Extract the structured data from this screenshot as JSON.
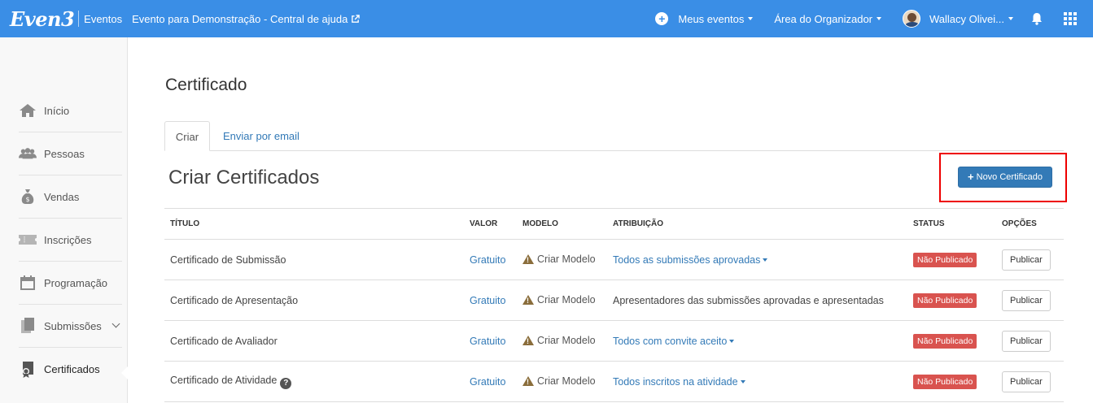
{
  "topbar": {
    "logo": "Even3",
    "brand_sub": "Eventos",
    "event_title": "Evento para Demonstração - Central de ajuda",
    "menu_events": "Meus eventos",
    "menu_organizer": "Área do Organizador",
    "user_name": "Wallacy Olivei...",
    "bg_color": "#3a8ee6"
  },
  "sidebar": {
    "items": [
      {
        "label": "Início",
        "icon": "home-icon"
      },
      {
        "label": "Pessoas",
        "icon": "people-icon"
      },
      {
        "label": "Vendas",
        "icon": "money-bag-icon"
      },
      {
        "label": "Inscrições",
        "icon": "ticket-icon"
      },
      {
        "label": "Programação",
        "icon": "calendar-icon"
      },
      {
        "label": "Submissões",
        "icon": "documents-icon"
      },
      {
        "label": "Certificados",
        "icon": "certificate-icon"
      }
    ]
  },
  "main": {
    "page_title": "Certificado",
    "tabs": [
      {
        "label": "Criar",
        "active": true
      },
      {
        "label": "Enviar por email",
        "active": false
      }
    ],
    "section_title": "Criar Certificados",
    "new_button": "Novo Certificado",
    "columns": [
      "TÍTULO",
      "VALOR",
      "MODELO",
      "ATRIBUIÇÃO",
      "STATUS",
      "OPÇÕES"
    ],
    "rows": [
      {
        "title": "Certificado de Submissão",
        "valor": "Gratuito",
        "modelo": "Criar Modelo",
        "atribuicao": "Todos as submissões aprovadas",
        "atribuicao_dropdown": true,
        "status": "Não Publicado",
        "opcao": "Publicar",
        "help": false
      },
      {
        "title": "Certificado de Apresentação",
        "valor": "Gratuito",
        "modelo": "Criar Modelo",
        "atribuicao": "Apresentadores das submissões aprovadas e apresentadas",
        "atribuicao_dropdown": false,
        "status": "Não Publicado",
        "opcao": "Publicar",
        "help": false
      },
      {
        "title": "Certificado de Avaliador",
        "valor": "Gratuito",
        "modelo": "Criar Modelo",
        "atribuicao": "Todos com convite aceito",
        "atribuicao_dropdown": true,
        "status": "Não Publicado",
        "opcao": "Publicar",
        "help": false
      },
      {
        "title": "Certificado de Atividade",
        "valor": "Gratuito",
        "modelo": "Criar Modelo",
        "atribuicao": "Todos inscritos na atividade",
        "atribuicao_dropdown": true,
        "status": "Não Publicado",
        "opcao": "Publicar",
        "help": true
      }
    ],
    "status_color": "#d9534f",
    "primary_color": "#337ab7"
  }
}
